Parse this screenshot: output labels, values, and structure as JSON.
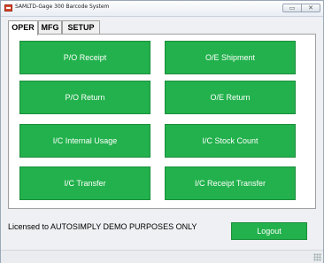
{
  "window": {
    "title": "SAMLTD-Gage 300 Barcode System",
    "minimize_glyph": "▭",
    "close_glyph": "✕",
    "icon": "app-icon"
  },
  "tabs": [
    {
      "label": "OPER",
      "active": true
    },
    {
      "label": "MFG",
      "active": false
    },
    {
      "label": "SETUP",
      "active": false
    }
  ],
  "buttons": {
    "po_receipt": "P/O Receipt",
    "oe_shipment": "O/E Shipment",
    "po_return": "P/O Return",
    "oe_return": "O/E Return",
    "ic_internal_usage": "I/C Internal Usage",
    "ic_stock_count": "I/C Stock Count",
    "ic_transfer": "I/C Transfer",
    "ic_receipt_transfer": "I/C Receipt Transfer"
  },
  "footer": {
    "license_text": "Licensed to AUTOSIMPLY DEMO PURPOSES ONLY",
    "logout_label": "Logout"
  },
  "colors": {
    "button_green": "#22b14c",
    "button_text": "#ffffff",
    "panel_bg": "#ffffff"
  }
}
